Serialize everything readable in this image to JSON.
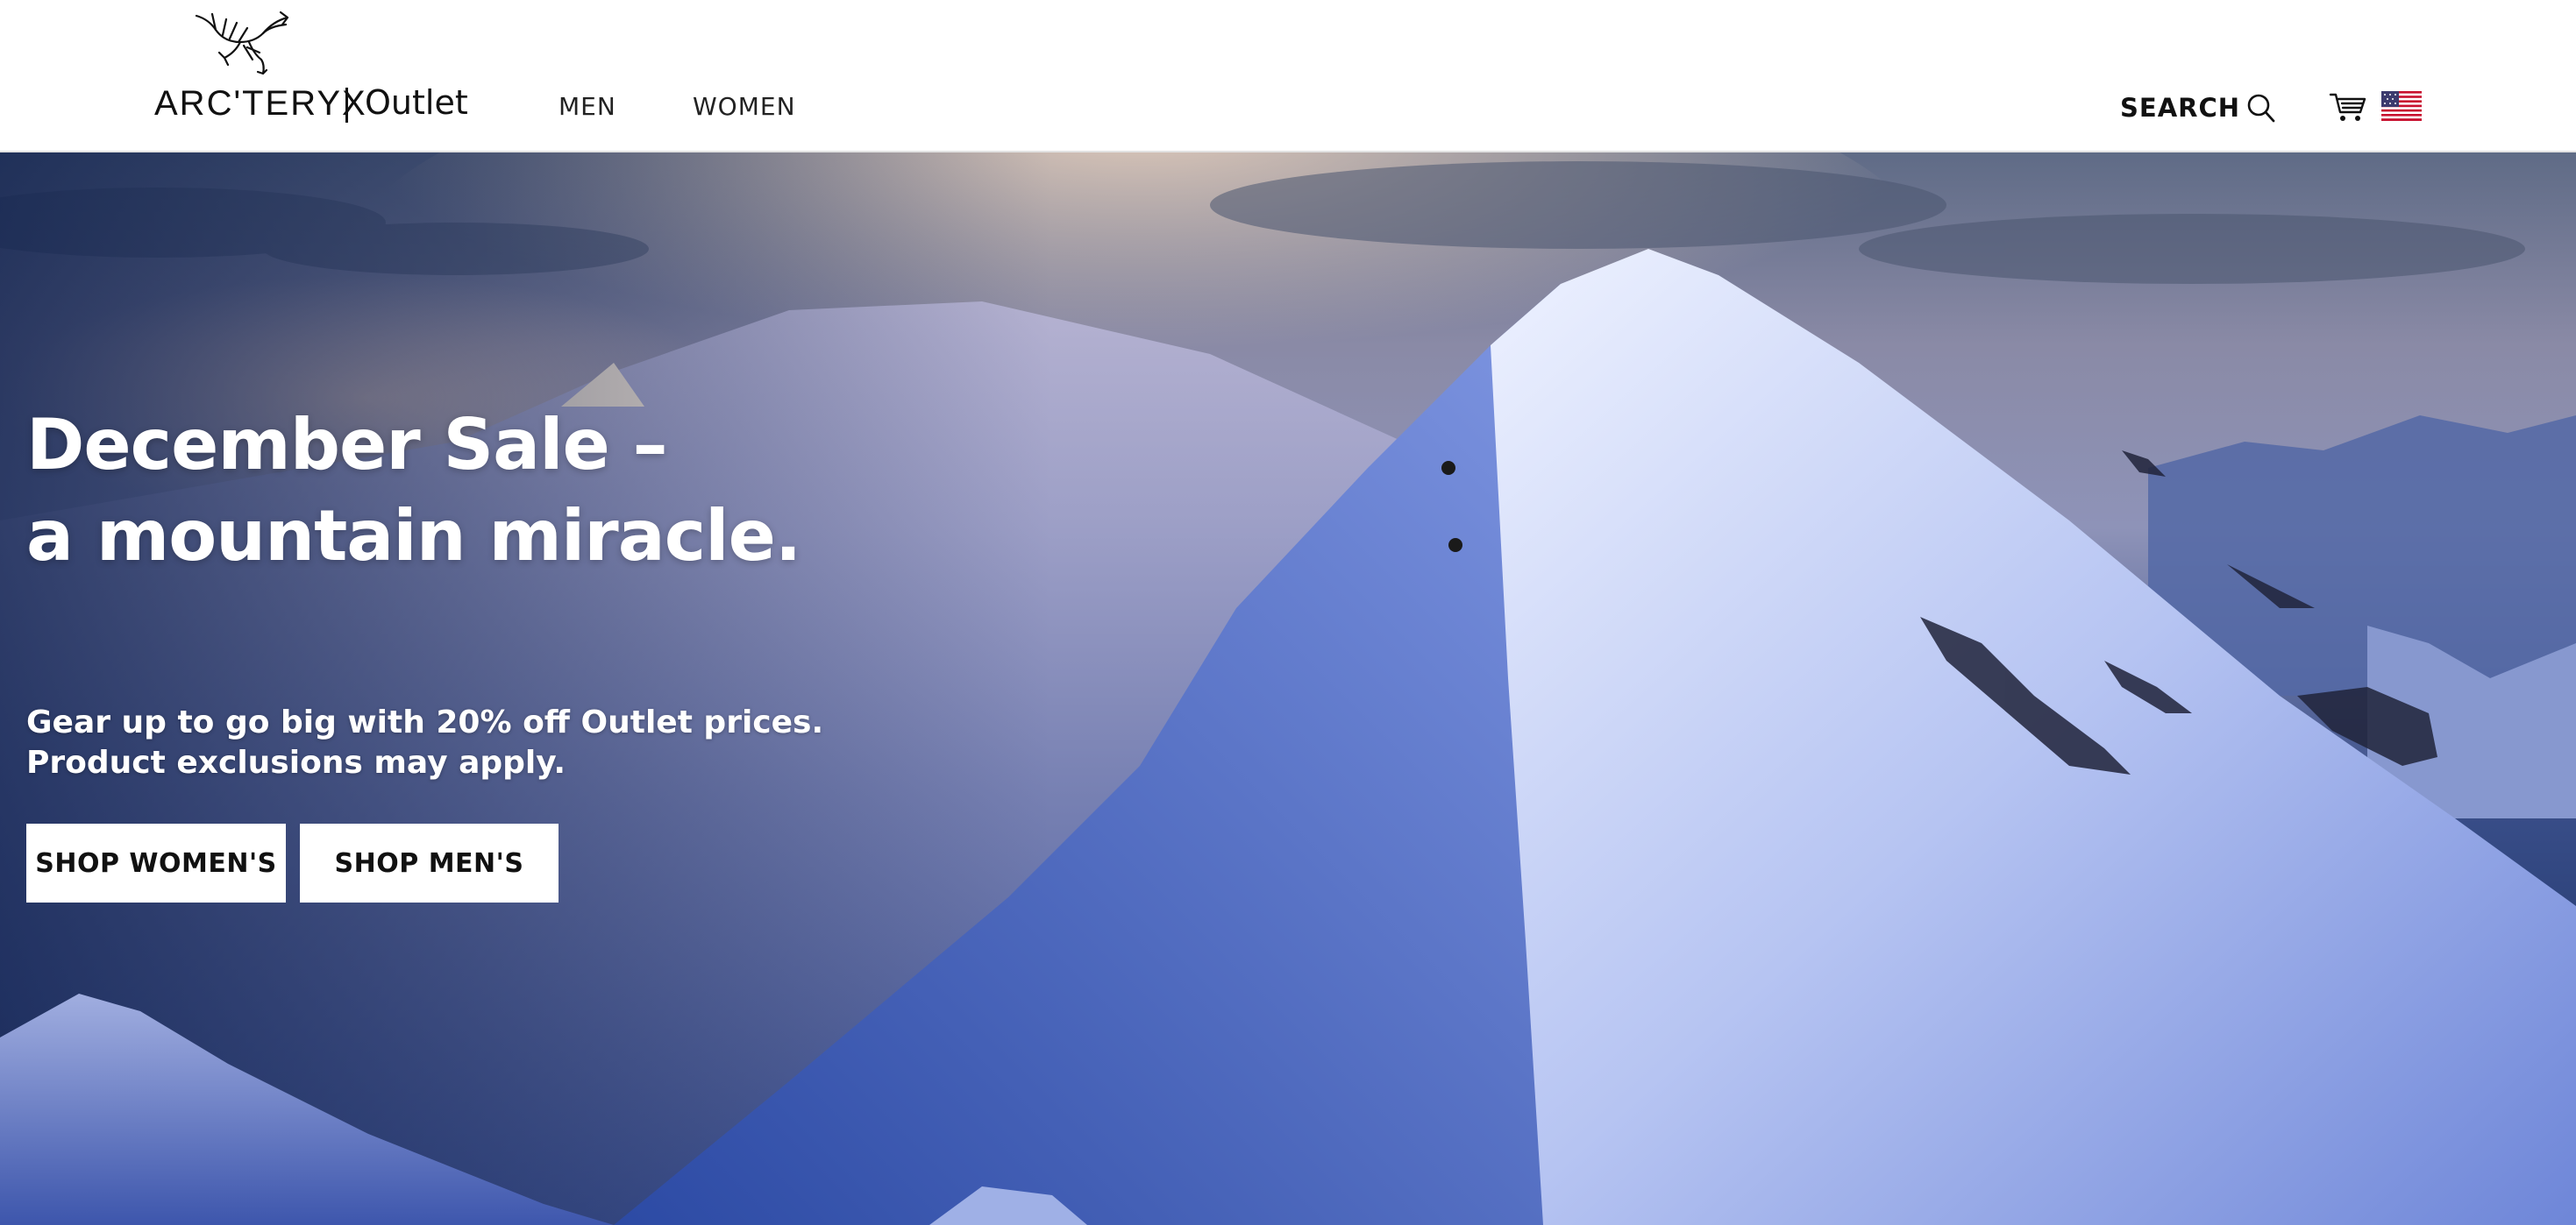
{
  "header": {
    "logo": {
      "brand": "ARC'TERYX",
      "suffix": "Outlet"
    },
    "nav": [
      {
        "label": "MEN"
      },
      {
        "label": "WOMEN"
      }
    ],
    "search_label": "SEARCH",
    "icons": {
      "search": "search-icon",
      "cart": "cart-icon",
      "locale": "us-flag-icon"
    }
  },
  "hero": {
    "title_line1": "December Sale –",
    "title_line2": "a mountain miracle.",
    "subtitle_line1": "Gear up to go big with 20% off Outlet prices.",
    "subtitle_line2": "Product exclusions may apply.",
    "buttons": [
      {
        "label": "SHOP WOMEN'S"
      },
      {
        "label": "SHOP MEN'S"
      }
    ]
  },
  "colors": {
    "header_bg": "#ffffff",
    "text_dark": "#111111",
    "hero_text": "#ffffff",
    "button_bg": "#ffffff"
  }
}
